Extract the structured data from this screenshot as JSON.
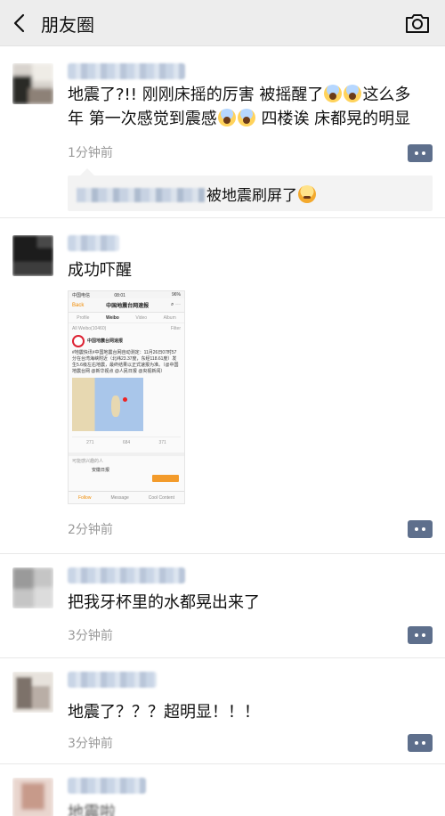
{
  "header": {
    "title": "朋友圈"
  },
  "posts": [
    {
      "text_lines": [
        "地震了?!! 刚刚床摇的厉害 被摇醒了",
        "这么多",
        "年 第一次感觉到震感",
        " 四楼诶 床都晃的明显"
      ],
      "time": "1分钟前",
      "comment": {
        "text": "被地震刷屏了"
      }
    },
    {
      "text": "成功吓醒",
      "time": "2分钟前",
      "screenshot": {
        "carrier": "中国电信",
        "clock": "08:01",
        "battery": "96%",
        "back_label": "Back",
        "title": "中国地震台网速报",
        "tabs": [
          "Profile",
          "Weibo",
          "Video",
          "Album"
        ],
        "filter_left": "All Weibo(10460)",
        "filter_right": "Filter",
        "account_name": "中国地震台网速报",
        "post_body": "#地震快讯#中国地震台网自动测定：11月26日07时57分在台湾海峡附近（北纬23.37度，东经118.61度）发生5.6级左右地震，最终结果以正式速报为准。（@中国地震台网 @新华视点 @人民日报 @央视新闻）",
        "reposts": "271",
        "comments": "684",
        "likes": "371",
        "recommend_label": "可能感兴趣的人",
        "recommend_name": "安徽日报",
        "bottom": [
          "Follow",
          "Message",
          "Cool Content"
        ]
      }
    },
    {
      "text": "把我牙杯里的水都晃出来了",
      "time": "3分钟前"
    },
    {
      "text": "地震了？？？超明显！！！",
      "time": "3分钟前"
    },
    {
      "text": "地震啦"
    }
  ],
  "icons": {
    "back": "chevron-left-icon",
    "camera": "camera-icon",
    "more": "more-dots-icon"
  },
  "colors": {
    "header_bg": "#ededed",
    "more_btn": "#5e6f8c",
    "timestamp": "#9a9a9a",
    "comment_bg": "#f3f3f3"
  }
}
